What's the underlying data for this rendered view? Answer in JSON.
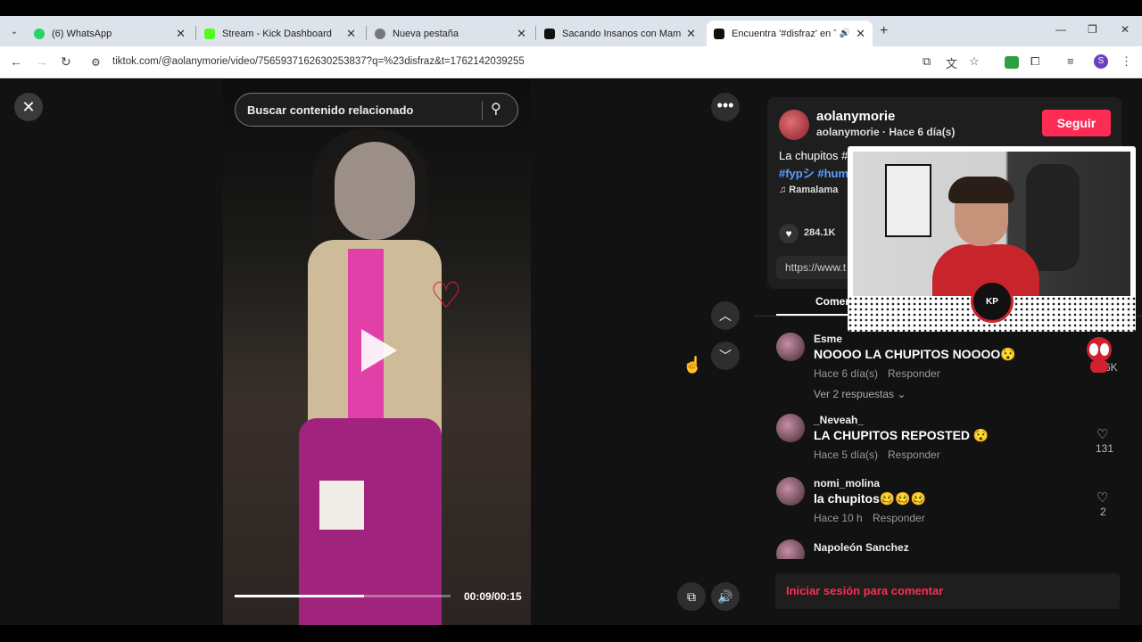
{
  "browser": {
    "tabs": [
      {
        "title": "(6) WhatsApp",
        "favicon_color": "#25d366",
        "close": "✕"
      },
      {
        "title": "Stream - Kick Dashboard",
        "favicon_color": "#53fc18",
        "close": "✕"
      },
      {
        "title": "Nueva pestaña",
        "favicon_color": "#777777",
        "close": "✕"
      },
      {
        "title": "Sacando Insanos con Mamá Co",
        "favicon_color": "#111111",
        "close": "✕"
      },
      {
        "title": "Encuentra '#disfraz' en TikT",
        "favicon_color": "#111111",
        "close": "✕",
        "active": true
      }
    ],
    "url": "tiktok.com/@aolanymorie/video/7565937162630253837?q=%23disfraz&t=1762142039255"
  },
  "video": {
    "search_placeholder": "Buscar contenido relacionado",
    "time": "00:09/00:15",
    "progress": 0.6
  },
  "post": {
    "username": "aolanymorie",
    "subline": "aolanymorie · Hace 6 día(s)",
    "follow_label": "Seguir",
    "description": "La chupitos #",
    "tags": "#fypシ #hum",
    "music": "♫  Ramalama",
    "likes": "284.1K",
    "link": "https://www.t",
    "comments_tab": "Comen"
  },
  "comments": [
    {
      "user": "Esme",
      "text": "NOOOO LA CHUPITOS NOOOO😯",
      "time": "Hace 6 día(s)",
      "reply": "Responder",
      "more": "Ver 2 respuestas ⌄",
      "likes": "6.6K"
    },
    {
      "user": "_Neveah_",
      "text": "LA CHUPITOS REPOSTED 😯",
      "time": "Hace 5 día(s)",
      "reply": "Responder",
      "likes": "131"
    },
    {
      "user": "nomi_molina",
      "text": "la chupitos🥴🥴🥴",
      "time": "Hace 10 h",
      "reply": "Responder",
      "likes": "2"
    },
    {
      "user": "Napoleón Sanchez"
    }
  ],
  "login_prompt": "Iniciar sesión para comentar"
}
